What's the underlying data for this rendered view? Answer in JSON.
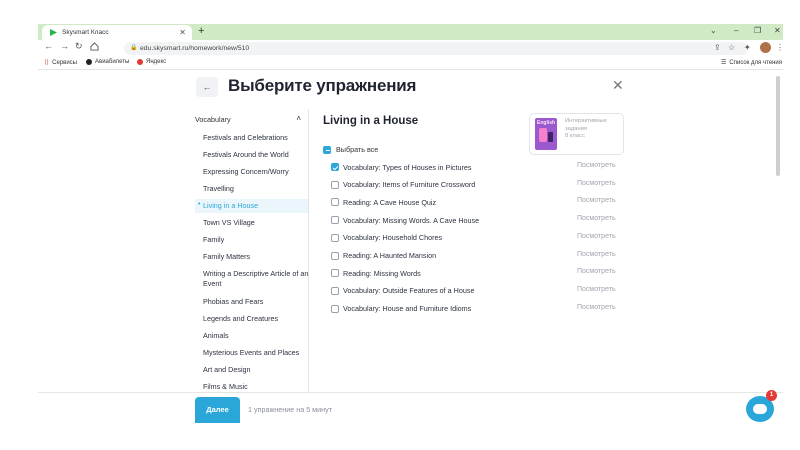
{
  "browser": {
    "tab_title": "Skysmart Класс",
    "new_tab": "+",
    "url": "edu.skysmart.ru/homework/new/510",
    "bookmarks": [
      "Сервисы",
      "Авиабилеты",
      "Яндекс"
    ],
    "reading_list": "Список для чтения"
  },
  "header": {
    "back": "←",
    "title": "Выберите упражнения",
    "close": "✕"
  },
  "sidebar": {
    "heading": "Vocabulary",
    "items": [
      "Festivals and Celebrations",
      "Festivals Around the World",
      "Expressing Concern/Worry",
      "Travelling",
      "Living in a House",
      "Town VS Village",
      "Family",
      "Family Matters",
      "Writing a Descriptive Article of an Event",
      "Phobias and Fears",
      "Legends and Creatures",
      "Animals",
      "Mysterious Events and Places",
      "Art and Design",
      "Films & Music"
    ],
    "active_index": 4
  },
  "content": {
    "section_title": "Living in a House",
    "card": {
      "cover_label": "English",
      "line1": "Интерактивные",
      "line2": "задания",
      "line3": "8 класс"
    },
    "select_all": "Выбрать все",
    "view_label": "Посмотреть",
    "exercises": [
      {
        "title": "Vocabulary: Types of Houses in Pictures",
        "checked": true
      },
      {
        "title": "Vocabulary: Items of Furniture Crossword",
        "checked": false
      },
      {
        "title": "Reading: A Cave House Quiz",
        "checked": false
      },
      {
        "title": "Vocabulary: Missing Words. A Cave House",
        "checked": false
      },
      {
        "title": "Vocabulary: Household Chores",
        "checked": false
      },
      {
        "title": "Reading: A Haunted Mansion",
        "checked": false
      },
      {
        "title": "Reading: Missing Words",
        "checked": false
      },
      {
        "title": "Vocabulary: Outside Features of a House",
        "checked": false
      },
      {
        "title": "Vocabulary: House and Furniture Idioms",
        "checked": false
      }
    ]
  },
  "footer": {
    "next_label": "Далее",
    "summary": "1 упражнение на 5 минут"
  },
  "chat": {
    "badge": "1"
  },
  "colors": {
    "accent": "#2aa7d8",
    "tabbar": "#cfeac5",
    "badge": "#e53935"
  }
}
